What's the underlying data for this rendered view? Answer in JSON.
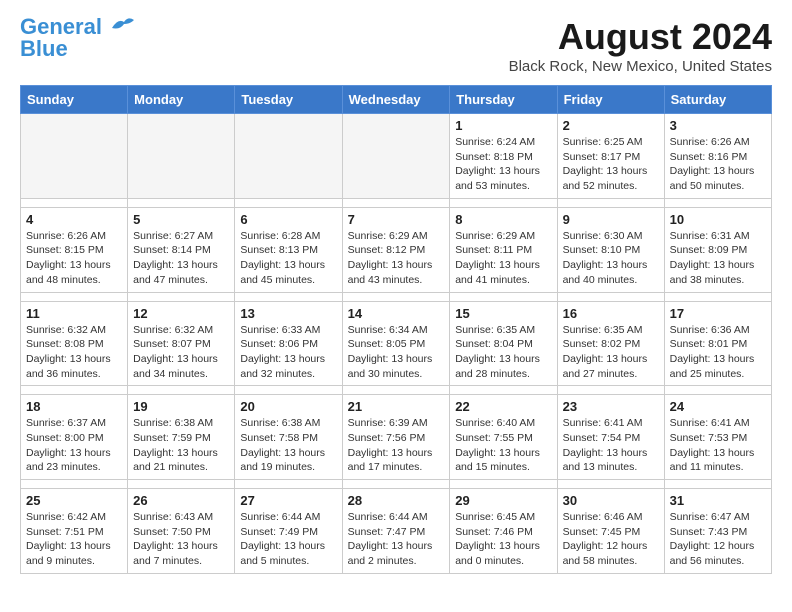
{
  "logo": {
    "text_general": "General",
    "text_blue": "Blue"
  },
  "title": "August 2024",
  "subtitle": "Black Rock, New Mexico, United States",
  "days_of_week": [
    "Sunday",
    "Monday",
    "Tuesday",
    "Wednesday",
    "Thursday",
    "Friday",
    "Saturday"
  ],
  "weeks": [
    [
      {
        "num": "",
        "info": ""
      },
      {
        "num": "",
        "info": ""
      },
      {
        "num": "",
        "info": ""
      },
      {
        "num": "",
        "info": ""
      },
      {
        "num": "1",
        "info": "Sunrise: 6:24 AM\nSunset: 8:18 PM\nDaylight: 13 hours\nand 53 minutes."
      },
      {
        "num": "2",
        "info": "Sunrise: 6:25 AM\nSunset: 8:17 PM\nDaylight: 13 hours\nand 52 minutes."
      },
      {
        "num": "3",
        "info": "Sunrise: 6:26 AM\nSunset: 8:16 PM\nDaylight: 13 hours\nand 50 minutes."
      }
    ],
    [
      {
        "num": "4",
        "info": "Sunrise: 6:26 AM\nSunset: 8:15 PM\nDaylight: 13 hours\nand 48 minutes."
      },
      {
        "num": "5",
        "info": "Sunrise: 6:27 AM\nSunset: 8:14 PM\nDaylight: 13 hours\nand 47 minutes."
      },
      {
        "num": "6",
        "info": "Sunrise: 6:28 AM\nSunset: 8:13 PM\nDaylight: 13 hours\nand 45 minutes."
      },
      {
        "num": "7",
        "info": "Sunrise: 6:29 AM\nSunset: 8:12 PM\nDaylight: 13 hours\nand 43 minutes."
      },
      {
        "num": "8",
        "info": "Sunrise: 6:29 AM\nSunset: 8:11 PM\nDaylight: 13 hours\nand 41 minutes."
      },
      {
        "num": "9",
        "info": "Sunrise: 6:30 AM\nSunset: 8:10 PM\nDaylight: 13 hours\nand 40 minutes."
      },
      {
        "num": "10",
        "info": "Sunrise: 6:31 AM\nSunset: 8:09 PM\nDaylight: 13 hours\nand 38 minutes."
      }
    ],
    [
      {
        "num": "11",
        "info": "Sunrise: 6:32 AM\nSunset: 8:08 PM\nDaylight: 13 hours\nand 36 minutes."
      },
      {
        "num": "12",
        "info": "Sunrise: 6:32 AM\nSunset: 8:07 PM\nDaylight: 13 hours\nand 34 minutes."
      },
      {
        "num": "13",
        "info": "Sunrise: 6:33 AM\nSunset: 8:06 PM\nDaylight: 13 hours\nand 32 minutes."
      },
      {
        "num": "14",
        "info": "Sunrise: 6:34 AM\nSunset: 8:05 PM\nDaylight: 13 hours\nand 30 minutes."
      },
      {
        "num": "15",
        "info": "Sunrise: 6:35 AM\nSunset: 8:04 PM\nDaylight: 13 hours\nand 28 minutes."
      },
      {
        "num": "16",
        "info": "Sunrise: 6:35 AM\nSunset: 8:02 PM\nDaylight: 13 hours\nand 27 minutes."
      },
      {
        "num": "17",
        "info": "Sunrise: 6:36 AM\nSunset: 8:01 PM\nDaylight: 13 hours\nand 25 minutes."
      }
    ],
    [
      {
        "num": "18",
        "info": "Sunrise: 6:37 AM\nSunset: 8:00 PM\nDaylight: 13 hours\nand 23 minutes."
      },
      {
        "num": "19",
        "info": "Sunrise: 6:38 AM\nSunset: 7:59 PM\nDaylight: 13 hours\nand 21 minutes."
      },
      {
        "num": "20",
        "info": "Sunrise: 6:38 AM\nSunset: 7:58 PM\nDaylight: 13 hours\nand 19 minutes."
      },
      {
        "num": "21",
        "info": "Sunrise: 6:39 AM\nSunset: 7:56 PM\nDaylight: 13 hours\nand 17 minutes."
      },
      {
        "num": "22",
        "info": "Sunrise: 6:40 AM\nSunset: 7:55 PM\nDaylight: 13 hours\nand 15 minutes."
      },
      {
        "num": "23",
        "info": "Sunrise: 6:41 AM\nSunset: 7:54 PM\nDaylight: 13 hours\nand 13 minutes."
      },
      {
        "num": "24",
        "info": "Sunrise: 6:41 AM\nSunset: 7:53 PM\nDaylight: 13 hours\nand 11 minutes."
      }
    ],
    [
      {
        "num": "25",
        "info": "Sunrise: 6:42 AM\nSunset: 7:51 PM\nDaylight: 13 hours\nand 9 minutes."
      },
      {
        "num": "26",
        "info": "Sunrise: 6:43 AM\nSunset: 7:50 PM\nDaylight: 13 hours\nand 7 minutes."
      },
      {
        "num": "27",
        "info": "Sunrise: 6:44 AM\nSunset: 7:49 PM\nDaylight: 13 hours\nand 5 minutes."
      },
      {
        "num": "28",
        "info": "Sunrise: 6:44 AM\nSunset: 7:47 PM\nDaylight: 13 hours\nand 2 minutes."
      },
      {
        "num": "29",
        "info": "Sunrise: 6:45 AM\nSunset: 7:46 PM\nDaylight: 13 hours\nand 0 minutes."
      },
      {
        "num": "30",
        "info": "Sunrise: 6:46 AM\nSunset: 7:45 PM\nDaylight: 12 hours\nand 58 minutes."
      },
      {
        "num": "31",
        "info": "Sunrise: 6:47 AM\nSunset: 7:43 PM\nDaylight: 12 hours\nand 56 minutes."
      }
    ]
  ]
}
